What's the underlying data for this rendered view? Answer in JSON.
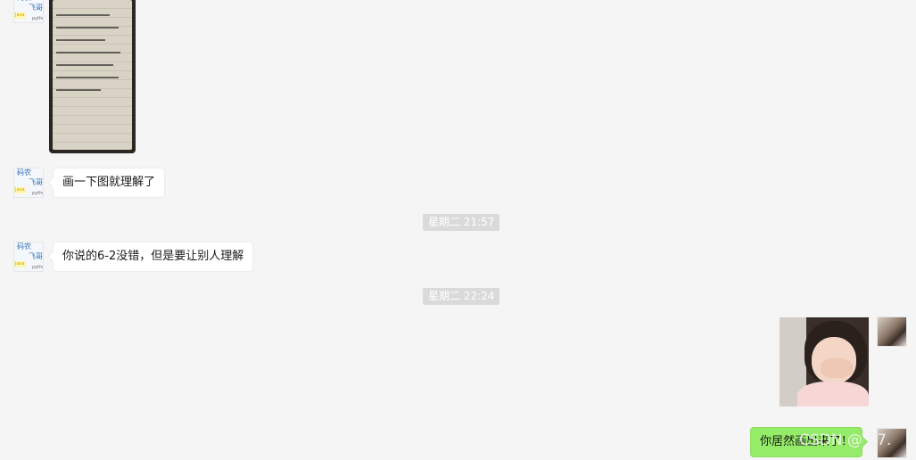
{
  "avatars": {
    "other": {
      "line1": "码农",
      "line2": "飞哥",
      "line3": "Java",
      "line4": "python"
    }
  },
  "messages": [
    {
      "sender": "other",
      "type": "image",
      "content": "handwritten notebook page photo"
    },
    {
      "sender": "other",
      "type": "text",
      "text": "画一下图就理解了"
    },
    {
      "type": "time",
      "text": "星期二 21:57"
    },
    {
      "sender": "other",
      "type": "text",
      "text": "你说的6-2没错，但是要让别人理解"
    },
    {
      "type": "time",
      "text": "星期二 22:24"
    },
    {
      "sender": "me",
      "type": "sticker",
      "content": "little-girl-laughing-sticker"
    },
    {
      "sender": "me",
      "type": "text",
      "text": "你居然画出来了！"
    }
  ],
  "watermark": {
    "text": "CSDN @ 27."
  },
  "colors": {
    "background": "#f5f5f5",
    "incoming_bubble": "#ffffff",
    "outgoing_bubble": "#95ec69",
    "time_badge": "#dadada"
  }
}
